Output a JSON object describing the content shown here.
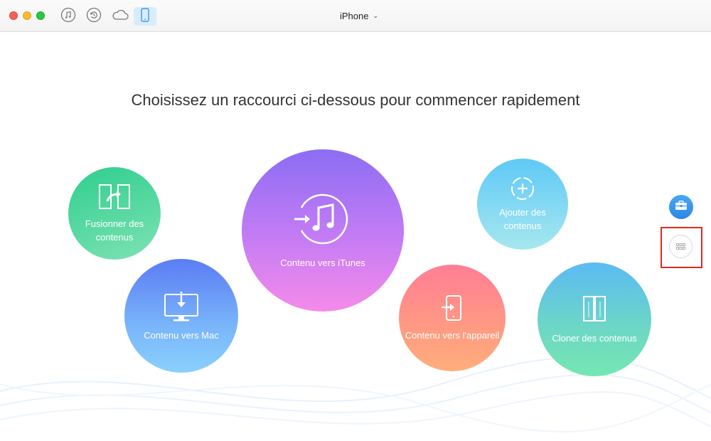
{
  "window": {
    "device_name": "iPhone",
    "toolbar": {
      "buttons": [
        {
          "name": "itunes-library",
          "icon": "music-note-icon"
        },
        {
          "name": "backup-manager",
          "icon": "restore-icon"
        },
        {
          "name": "icloud-manager",
          "icon": "cloud-icon"
        },
        {
          "name": "device-manager",
          "icon": "iphone-icon",
          "active": true
        }
      ]
    }
  },
  "main": {
    "headline": "Choisissez un raccourci ci-dessous pour commencer rapidement",
    "shortcuts": {
      "merge": {
        "line1": "Fusionner des",
        "line2": "contenus",
        "icon": "merge-devices-icon",
        "color": "#2fce8e"
      },
      "to_mac": {
        "label": "Contenu vers Mac",
        "icon": "monitor-download-icon",
        "color": "#6b9bf6"
      },
      "to_itunes": {
        "label": "Contenu vers iTunes",
        "icon": "itunes-transfer-icon",
        "color": "#c57cf4"
      },
      "add": {
        "line1": "Ajouter des",
        "line2": "contenus",
        "icon": "add-circle-icon",
        "color": "#7fd7f2"
      },
      "to_device": {
        "label": "Contenu vers l'appareil",
        "icon": "phone-import-icon",
        "color": "#ff8c8c"
      },
      "clone": {
        "label": "Cloner des contenus",
        "icon": "clone-devices-icon",
        "color": "#68ccd6"
      }
    }
  },
  "side_panel": {
    "toolbox": {
      "icon": "toolbox-icon",
      "color": "#3a98ec"
    },
    "grid": {
      "icon": "grid-icon"
    },
    "highlight_color": "#e0291f"
  }
}
